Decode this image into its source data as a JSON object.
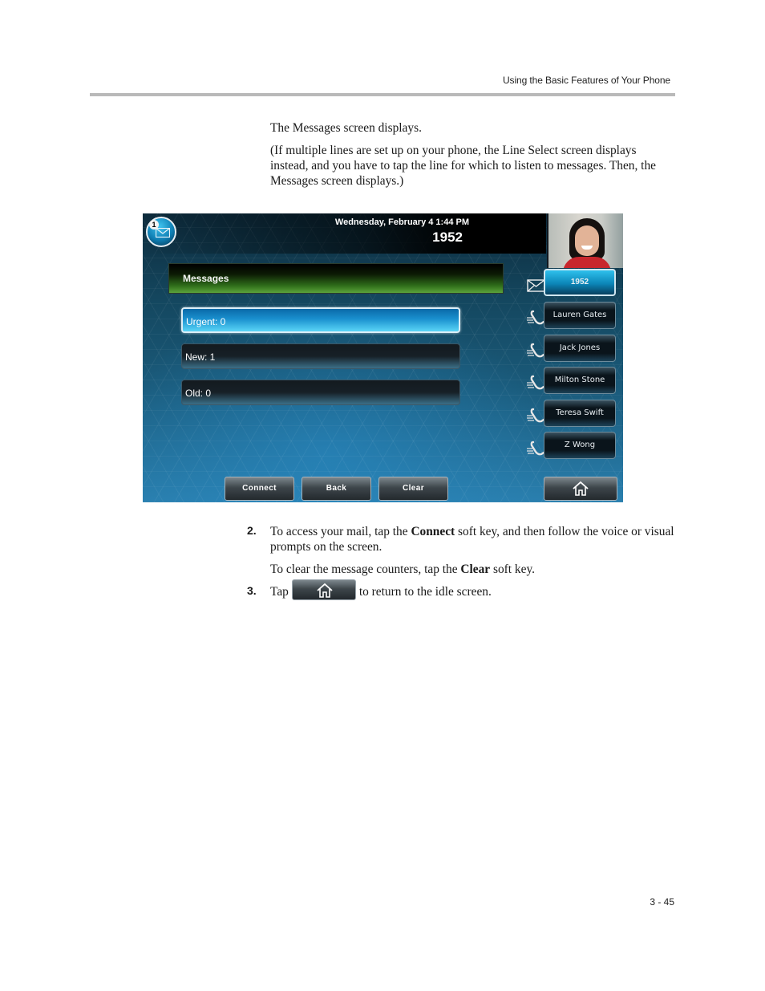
{
  "header": {
    "running_title": "Using the Basic Features of Your Phone"
  },
  "intro": {
    "p1": "The Messages screen displays.",
    "p2": "(If multiple lines are set up on your phone, the Line Select screen displays instead, and you have to tap the line for which to listen to messages. Then, the Messages screen displays.)"
  },
  "phone": {
    "status": {
      "datetime": "Wednesday, February 4  1:44 PM",
      "extension": "1952"
    },
    "message_badge": {
      "count": "1",
      "icon": "envelope-icon"
    },
    "screen_title": "Messages",
    "message_counters": [
      {
        "label": "Urgent: 0",
        "selected": true
      },
      {
        "label": "New: 1",
        "selected": false
      },
      {
        "label": "Old: 0",
        "selected": false
      }
    ],
    "line_keys": [
      {
        "label": "1952",
        "icon": "envelope-icon",
        "primary": true
      },
      {
        "label": "Lauren Gates",
        "icon": "speed-dial-phone-icon"
      },
      {
        "label": "Jack Jones",
        "icon": "speed-dial-phone-icon"
      },
      {
        "label": "Milton Stone",
        "icon": "speed-dial-phone-icon"
      },
      {
        "label": "Teresa Swift",
        "icon": "speed-dial-phone-icon"
      },
      {
        "label": "Z Wong",
        "icon": "speed-dial-phone-icon"
      }
    ],
    "soft_keys": [
      "Connect",
      "Back",
      "Clear"
    ],
    "home_key_icon": "home-icon",
    "colors": {
      "title_bar_green": "#5ba33b",
      "selected_blue": "#1a90cf",
      "primary_line_blue": "#0c86b8"
    }
  },
  "steps": [
    {
      "number": "2.",
      "pre": "To access your mail, tap the ",
      "bold": "Connect",
      "post": " soft key, and then follow the voice or visual prompts on the screen.",
      "sub_pre": "To clear the message counters, tap the ",
      "sub_bold": "Clear",
      "sub_post": " soft key."
    },
    {
      "number": "3.",
      "pre": "Tap",
      "post": "to return to the idle screen."
    }
  ],
  "footer": {
    "page_number": "3 - 45"
  }
}
